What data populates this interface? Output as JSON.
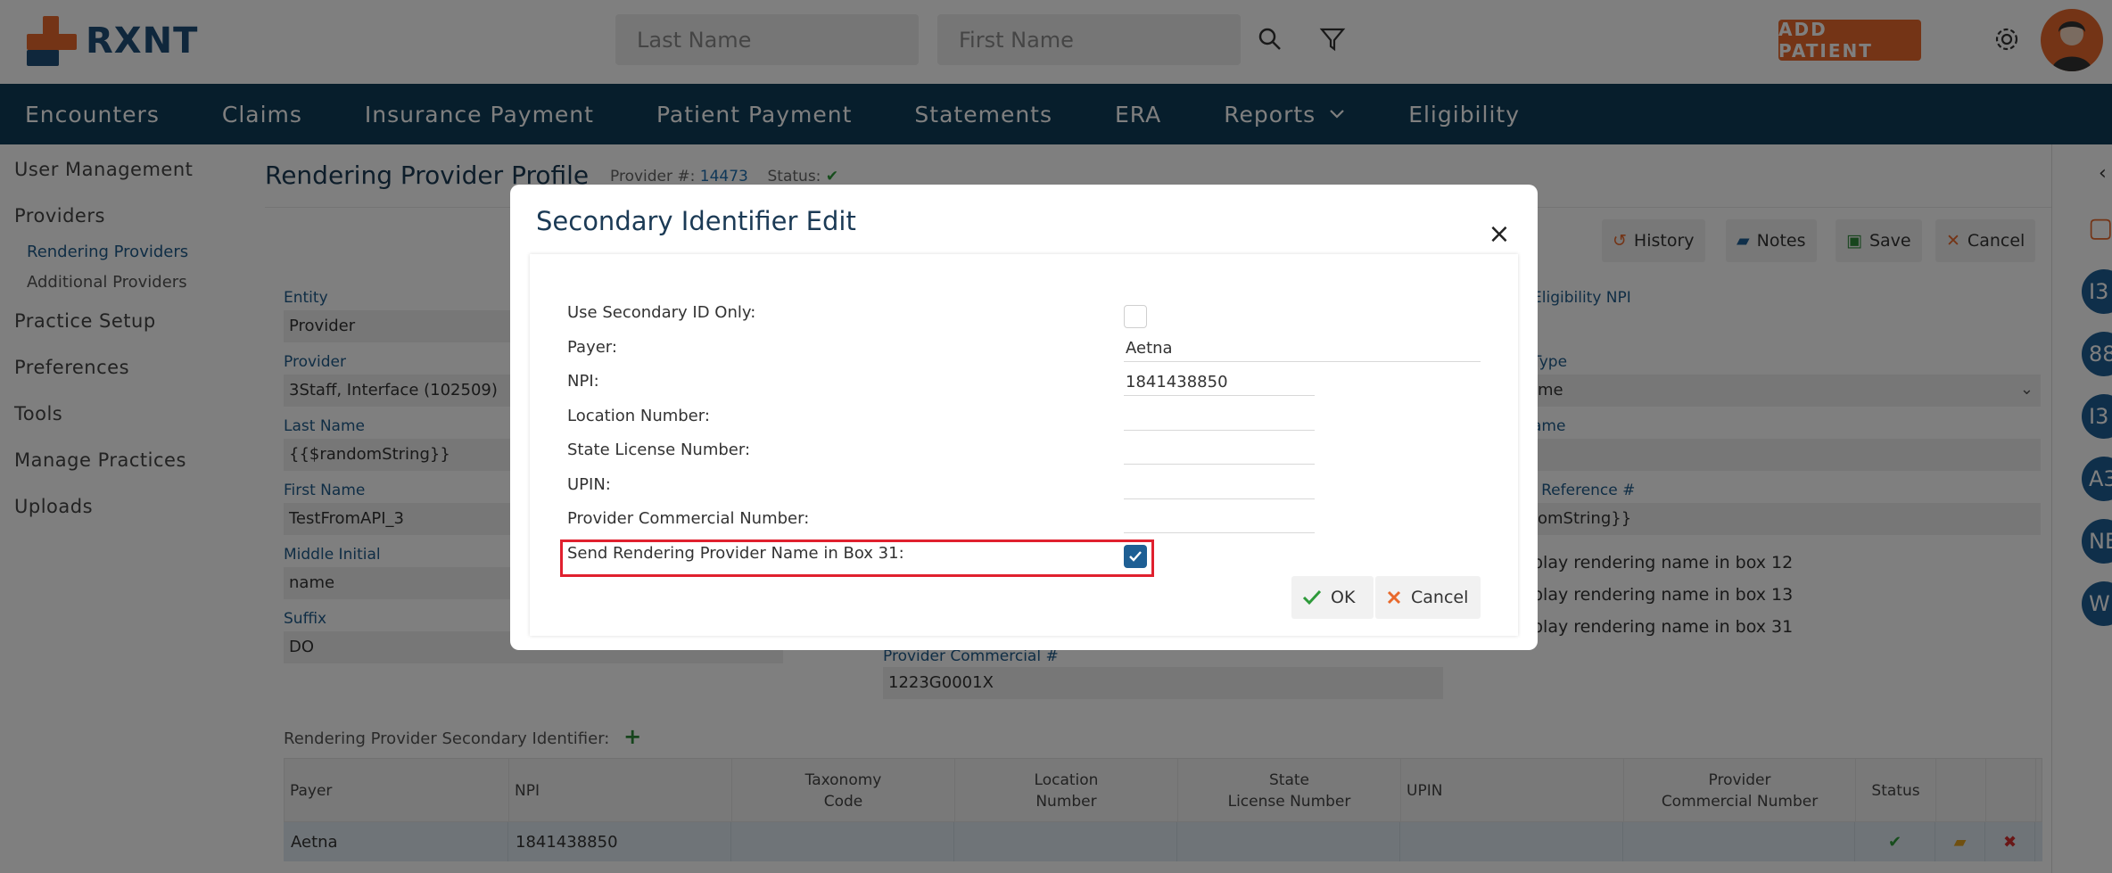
{
  "header": {
    "logo_text": "RXNT",
    "last_name_placeholder": "Last Name",
    "first_name_placeholder": "First Name",
    "add_patient_label": "ADD PATIENT"
  },
  "nav": {
    "items": [
      "Encounters",
      "Claims",
      "Insurance Payment",
      "Patient Payment",
      "Statements",
      "ERA",
      "Reports",
      "Eligibility"
    ]
  },
  "sidebar": {
    "user_management": "User Management",
    "providers": "Providers",
    "rendering_providers": "Rendering Providers",
    "additional_providers": "Additional Providers",
    "practice_setup": "Practice Setup",
    "preferences": "Preferences",
    "tools": "Tools",
    "manage_practices": "Manage Practices",
    "uploads": "Uploads"
  },
  "profile": {
    "title": "Rendering Provider Profile",
    "provider_num_label": "Provider #:",
    "provider_num": "14473",
    "status_label": "Status:",
    "toolbar": {
      "history": "History",
      "notes": "Notes",
      "save": "Save",
      "cancel": "Cancel"
    },
    "fields": {
      "entity_label": "Entity",
      "entity_value": "Provider",
      "provider_label": "Provider",
      "provider_value": "3Staff, Interface  (102509)",
      "last_name_label": "Last Name",
      "last_name_value": "{{$randomString}}",
      "first_name_label": "First Name",
      "first_name_value": "TestFromAPI_3",
      "middle_initial_label": "Middle Initial",
      "middle_initial_value": "name",
      "suffix_label": "Suffix",
      "suffix_value": "DO",
      "provider_commercial_label": "Provider Commercial #",
      "provider_commercial_value": "1223G0001X",
      "eligibility_npi_label": "Eligibility NPI",
      "type_label": "Type",
      "type_value": "me",
      "name_label": "ame",
      "reference_label": "l Reference #",
      "reference_value": "omString}}",
      "box12": "play rendering name in box 12",
      "box13": "play rendering name in box 13",
      "box31": "play rendering name in box 31"
    }
  },
  "secondary_section": {
    "title": "Rendering Provider Secondary Identifier:",
    "columns": [
      "Payer",
      "NPI",
      "Taxonomy\nCode",
      "Location\nNumber",
      "State\nLicense Number",
      "UPIN",
      "Provider\nCommercial Number",
      "Status"
    ],
    "rows": [
      {
        "payer": "Aetna",
        "npi": "1841438850"
      }
    ]
  },
  "rail": {
    "badges": [
      "I3",
      "88",
      "I3",
      "A3",
      "NE",
      "W"
    ]
  },
  "modal": {
    "title": "Secondary Identifier Edit",
    "labels": {
      "use_secondary": "Use Secondary ID Only:",
      "payer": "Payer:",
      "npi": "NPI:",
      "location_number": "Location Number:",
      "state_license": "State License Number:",
      "upin": "UPIN:",
      "provider_commercial": "Provider Commercial Number:",
      "send_rendering": "Send Rendering Provider Name in Box 31:"
    },
    "values": {
      "payer": "Aetna",
      "npi": "1841438850",
      "location_number": "",
      "state_license": "",
      "upin": "",
      "provider_commercial": ""
    },
    "use_secondary_checked": false,
    "send_rendering_checked": true,
    "ok_label": "OK",
    "cancel_label": "Cancel"
  }
}
